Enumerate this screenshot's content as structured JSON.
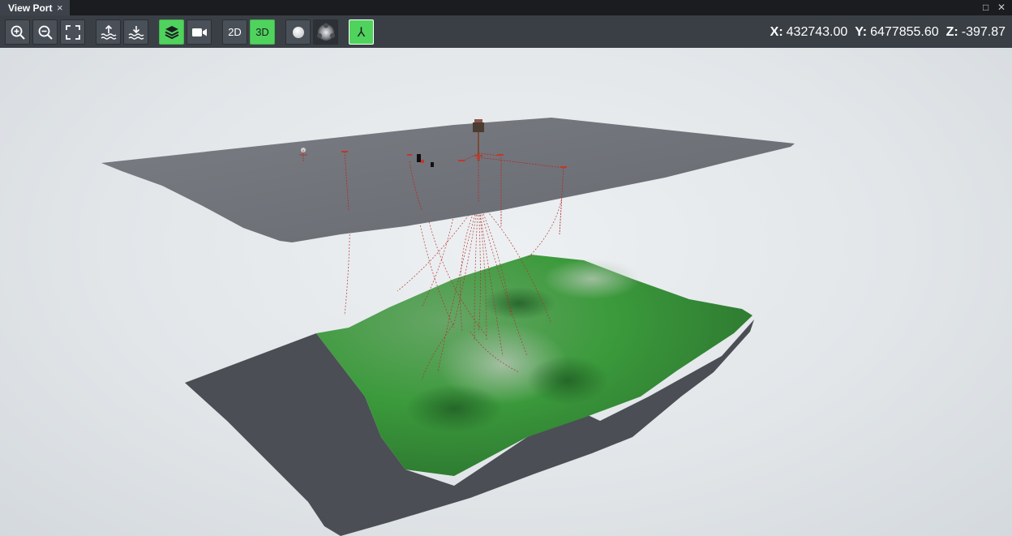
{
  "window": {
    "tab_title": "View Port",
    "close_glyph": "×",
    "maximize_glyph": "□",
    "window_close_glyph": "✕"
  },
  "toolbar": {
    "buttons": [
      {
        "name": "zoom-in-button",
        "icon": "zoom-in-icon",
        "active": false
      },
      {
        "name": "zoom-out-button",
        "icon": "zoom-out-icon",
        "active": false
      },
      {
        "name": "fit-view-button",
        "icon": "fullscreen-icon",
        "active": false
      },
      {
        "name": "raise-surface-button",
        "icon": "sea-level-up-icon",
        "active": false
      },
      {
        "name": "lower-surface-button",
        "icon": "sea-level-down-icon",
        "active": false
      },
      {
        "name": "layers-button",
        "icon": "layers-icon",
        "active": true
      },
      {
        "name": "camera-button",
        "icon": "video-camera-icon",
        "active": false
      },
      {
        "name": "view-2d-button",
        "label": "2D",
        "active": false
      },
      {
        "name": "view-3d-button",
        "label": "3D",
        "active": true
      },
      {
        "name": "light-sphere-button",
        "icon": "light-sphere-icon",
        "active": false
      },
      {
        "name": "shaded-sphere-button",
        "icon": "shaded-sphere-icon",
        "active": false
      },
      {
        "name": "lambda-button",
        "label": "λ",
        "active": true
      }
    ],
    "label_2d": "2D",
    "label_3d": "3D",
    "label_lambda": "⅄"
  },
  "coordinates": {
    "x_label": "X:",
    "x_value": "432743.00",
    "y_label": "Y:",
    "y_value": "6477855.60",
    "z_label": "Z:",
    "z_value": "-397.87"
  },
  "colors": {
    "accent_green": "#4fd35d",
    "toolbar_bg": "#3a3f46",
    "sea_surface": "#6d7076",
    "seabed_dark": "#4a4d54",
    "seabed_green": "#3f9a3f",
    "mooring_red": "#c0392b"
  }
}
